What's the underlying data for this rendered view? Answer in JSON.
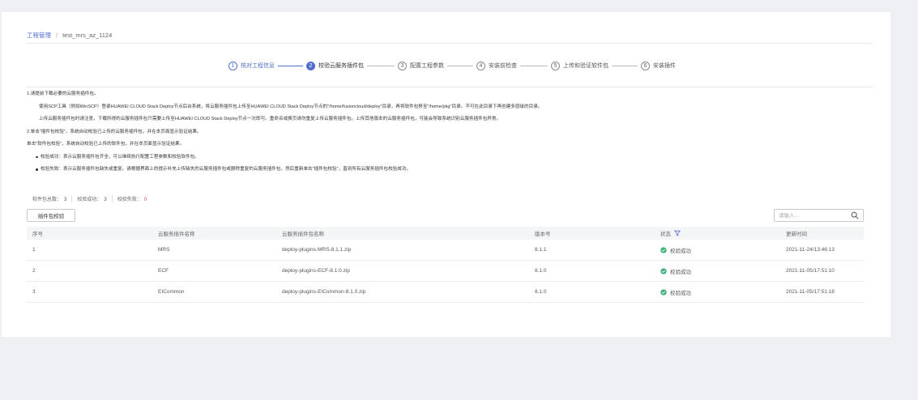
{
  "breadcrumb": {
    "root": "工程管理",
    "separator": "/",
    "current": "test_mrs_az_1124"
  },
  "steps": [
    {
      "num": "1",
      "label": "核对工程信息",
      "state": "done"
    },
    {
      "num": "2",
      "label": "校验云服务插件包",
      "state": "active"
    },
    {
      "num": "3",
      "label": "配置工程参数",
      "state": "pending"
    },
    {
      "num": "4",
      "label": "安装前检查",
      "state": "pending"
    },
    {
      "num": "5",
      "label": "上传和验证软件包",
      "state": "pending"
    },
    {
      "num": "6",
      "label": "安装插件",
      "state": "pending"
    }
  ],
  "instructions": {
    "line1": "1.请提前下载必要的云服务插件包。",
    "line2": "使用SCP工具（例如WinSCP）登录HUAWEI CLOUD Stack Deploy节点后台系统，将云服务插件包上传至HUAWEI CLOUD Stack Deploy节点的\"/home/fusioncloud/deploy\"目录，再将软件包移至\"/home/pkg\"目录。不可在此目录下再创建多层级的目录。",
    "line3": "上传云服务插件包时请注意，下载所得的云服务插件包只需要上传至HUAWEI CLOUD Stack Deploy节点一次即可。重命名或换页请勿重复上传云服务插件包。上传其他版本的云服务插件包，可能会导致系统识别云服务插件包异常。",
    "line4": "2.单击\"插件包校验\"，系统自动校验已上传的云服务插件包，并在本页面显示验证结果。",
    "line5": "单击\"软件包校验\"，系统自动校验已上传的软件包，并在本页面显示验证结果。",
    "bullet1": "校验成功：表示云服务插件包齐全，可以继续执行配置工程参数和校验软件包。",
    "bullet2": "校验失败：表示云服务插件包缺失或重复。请根据界面上的提示补充上传缺失的云服务插件包或删除重复的云服务插件包，然后重新单击\"插件包校验\"，直到所有云服务插件包校验成功。"
  },
  "stats": [
    {
      "label": "软件包总数：",
      "value": "3",
      "status": "normal"
    },
    {
      "label": "校验成功：",
      "value": "3",
      "status": "normal"
    },
    {
      "label": "校验失败：",
      "value": "0",
      "status": "error"
    }
  ],
  "toolbar": {
    "verify_button": "插件包校验",
    "search_placeholder": "请输入..."
  },
  "table": {
    "headers": [
      "序号",
      "云服务插件名称",
      "云服务插件包名称",
      "版本号",
      "状态",
      "更新时间"
    ],
    "rows": [
      {
        "no": "1",
        "name": "MRS",
        "pkg": "deploy-plugins-MRS-8.1.1.zip",
        "version": "8.1.1",
        "status": "校验成功",
        "time": "2021-11-24/13:46:13"
      },
      {
        "no": "2",
        "name": "ECF",
        "pkg": "deploy-plugins-ECF-8.1.0.zip",
        "version": "8.1.0",
        "status": "校验成功",
        "time": "2021-11-05/17:51:10"
      },
      {
        "no": "3",
        "name": "EICommon",
        "pkg": "deploy-plugins-EICommon-8.1.0.zip",
        "version": "8.1.0",
        "status": "校验成功",
        "time": "2021-11-05/17:51:18"
      }
    ]
  },
  "colors": {
    "accent": "#526ecc",
    "success": "#3fb27f",
    "error": "#e54545"
  },
  "icons": {
    "search": "search-icon",
    "filter": "filter-icon",
    "success": "check-circle-icon"
  }
}
